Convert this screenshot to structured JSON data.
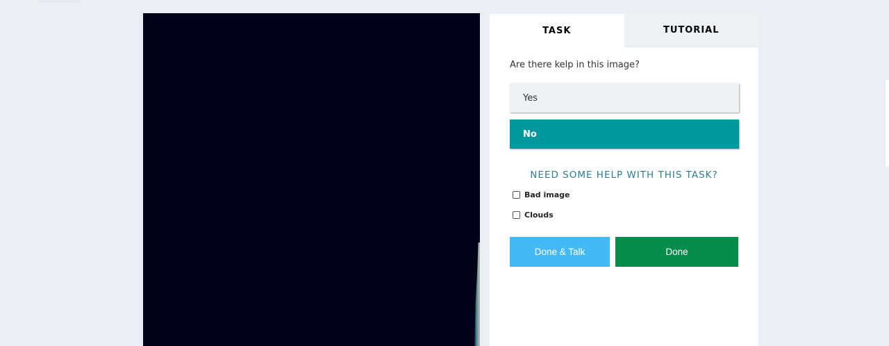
{
  "tabs": [
    {
      "label": "TASK",
      "active": true
    },
    {
      "label": "TUTORIAL",
      "active": false
    }
  ],
  "task": {
    "question": "Are there kelp in this image?",
    "answers": [
      {
        "label": "Yes",
        "selected": false
      },
      {
        "label": "No",
        "selected": true
      }
    ],
    "help_link": "NEED SOME HELP WITH THIS TASK?"
  },
  "flags": [
    {
      "label": "Bad image",
      "checked": false
    },
    {
      "label": "Clouds",
      "checked": false
    }
  ],
  "buttons": {
    "done_talk": "Done & Talk",
    "done": "Done"
  },
  "colors": {
    "selected_answer": "#00979d",
    "done_talk": "#43baf5",
    "done": "#078c4b",
    "help_link": "#2b7f8f"
  }
}
